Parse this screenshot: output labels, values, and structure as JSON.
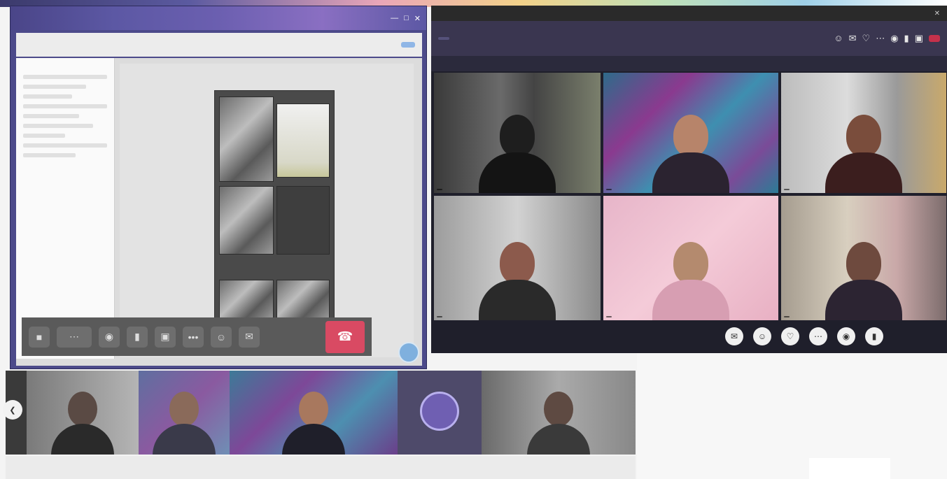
{
  "editor": {
    "title_tabs": [
      "",
      "",
      "",
      ""
    ],
    "ribbon_items": [
      "",
      "",
      "",
      "",
      "",
      "",
      "",
      ""
    ],
    "share_label": "",
    "nav_header": ""
  },
  "meeting": {
    "window_title": "",
    "timer": "",
    "leave_label": "",
    "banner_title": "",
    "banner_text": "",
    "banner_link": "",
    "participants": [
      {
        "name": ""
      },
      {
        "name": ""
      },
      {
        "name": ""
      },
      {
        "name": ""
      },
      {
        "name": ""
      },
      {
        "name": ""
      }
    ],
    "controls": [
      "chat-icon",
      "people-icon",
      "react-icon",
      "more-icon",
      "camera-icon",
      "mic-icon"
    ]
  },
  "colors": {
    "leave": "#c4314b",
    "end_task": "#d94a63",
    "editor_frame": "#4c4a8a"
  }
}
